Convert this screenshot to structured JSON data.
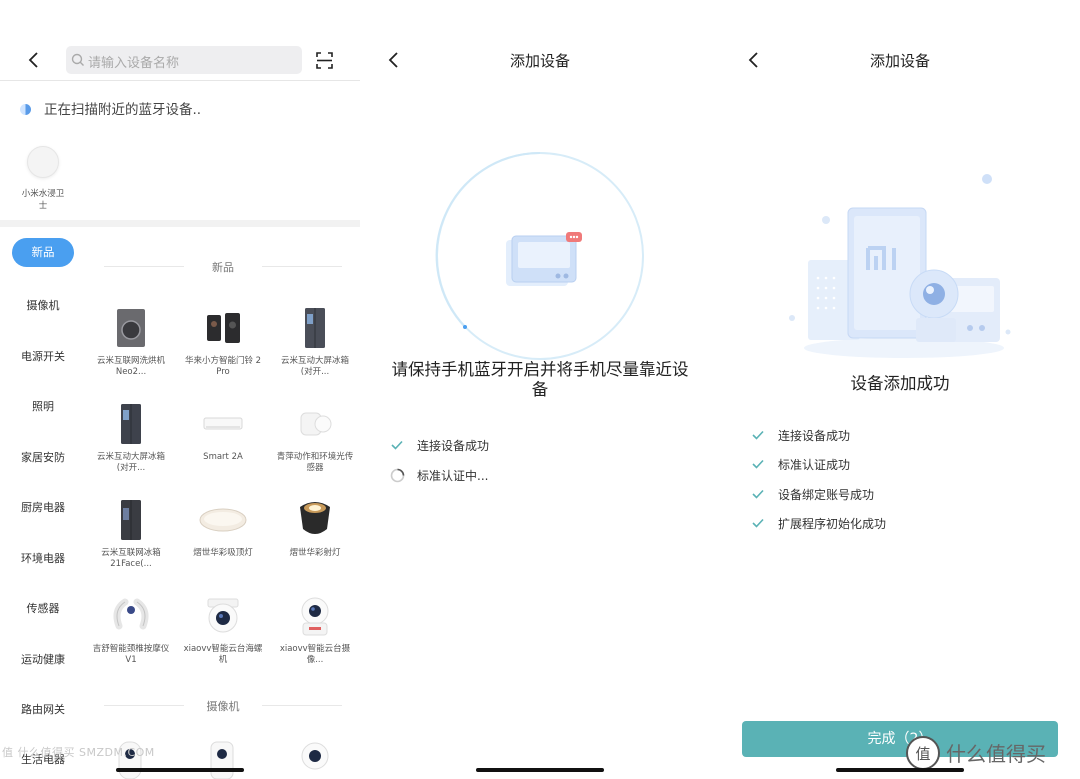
{
  "panel1": {
    "search_placeholder": "请输入设备名称",
    "scanning_text": "正在扫描附近的蓝牙设备..",
    "found_device": "小米水浸卫士",
    "categories": [
      "新品",
      "摄像机",
      "电源开关",
      "照明",
      "家居安防",
      "厨房电器",
      "环境电器",
      "传感器",
      "运动健康",
      "路由网关",
      "生活电器"
    ],
    "section_new": "新品",
    "section_camera": "摄像机",
    "products": [
      {
        "name": "云米互联网洗烘机Neo2...",
        "icon": "washer-icon"
      },
      {
        "name": "华来小方智能门铃 2 Pro",
        "icon": "doorbell-icon"
      },
      {
        "name": "云米互动大屏冰箱 (对开...",
        "icon": "fridge-icon"
      },
      {
        "name": "云米互动大屏冰箱 (对开...",
        "icon": "fridge-icon"
      },
      {
        "name": "Smart 2A",
        "icon": "air-conditioner-icon"
      },
      {
        "name": "青萍动作和环境光传感器",
        "icon": "motion-sensor-icon"
      },
      {
        "name": "云米互联网冰箱21Face(...",
        "icon": "fridge-icon"
      },
      {
        "name": "熠世华彩吸顶灯",
        "icon": "ceiling-light-icon"
      },
      {
        "name": "熠世华彩射灯",
        "icon": "spotlight-icon"
      },
      {
        "name": "吉舒智能颈椎按摩仪 V1",
        "icon": "neck-massager-icon"
      },
      {
        "name": "xiaovv智能云台海螺机",
        "icon": "ptz-camera-icon"
      },
      {
        "name": "xiaovv智能云台摄像...",
        "icon": "ptz-camera-icon"
      }
    ],
    "watermark": "值 什么值得买 SMZDM.COM"
  },
  "panel2": {
    "title": "添加设备",
    "message": "请保持手机蓝牙开启并将手机尽量靠近设备",
    "steps": [
      "连接设备成功",
      "标准认证中..."
    ]
  },
  "panel3": {
    "title": "添加设备",
    "success": "设备添加成功",
    "steps": [
      "连接设备成功",
      "标准认证成功",
      "设备绑定账号成功",
      "扩展程序初始化成功"
    ],
    "done_button": "完成（2）",
    "brand_logo": "值",
    "brand_text": "什么值得买"
  },
  "colors": {
    "accent": "#4a9ff0",
    "check": "#5ab2b5",
    "button": "#5ab2b5"
  }
}
